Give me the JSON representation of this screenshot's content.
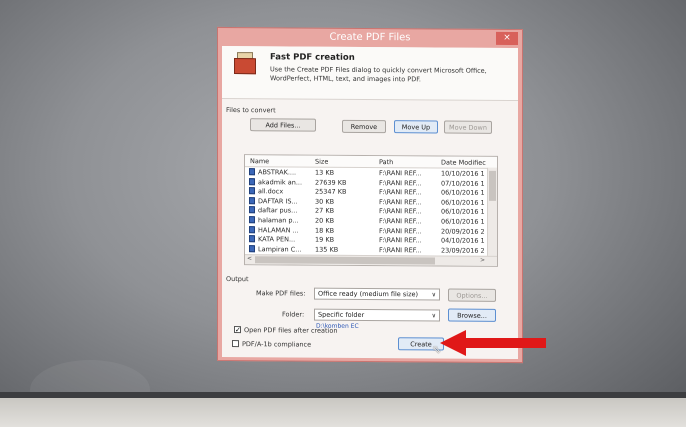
{
  "window": {
    "title": "Create PDF Files",
    "close_label": "×"
  },
  "header": {
    "title": "Fast PDF creation",
    "description": "Use the Create PDF Files dialog to quickly convert Microsoft Office, WordPerfect, HTML, text, and images into PDF."
  },
  "files_section": {
    "label": "Files to convert",
    "buttons": {
      "add": "Add Files...",
      "remove": "Remove",
      "move_up": "Move Up",
      "move_down": "Move Down"
    },
    "columns": [
      "Name",
      "Size",
      "Path",
      "Date Modifiec"
    ],
    "rows": [
      {
        "name": "ABSTRAK....",
        "size": "13 KB",
        "path": "F:\\RANI REF...",
        "date": "10/10/2016 1"
      },
      {
        "name": "akadmik an...",
        "size": "27639 KB",
        "path": "F:\\RANI REF...",
        "date": "07/10/2016 1"
      },
      {
        "name": "all.docx",
        "size": "25347 KB",
        "path": "F:\\RANI REF...",
        "date": "06/10/2016 1"
      },
      {
        "name": "DAFTAR IS...",
        "size": "30 KB",
        "path": "F:\\RANI REF...",
        "date": "06/10/2016 1"
      },
      {
        "name": "daftar pus...",
        "size": "27 KB",
        "path": "F:\\RANI REF...",
        "date": "06/10/2016 1"
      },
      {
        "name": "halaman p...",
        "size": "20 KB",
        "path": "F:\\RANI REF...",
        "date": "06/10/2016 1"
      },
      {
        "name": "HALAMAN ...",
        "size": "18 KB",
        "path": "F:\\RANI REF...",
        "date": "20/09/2016 2"
      },
      {
        "name": "KATA PEN...",
        "size": "19 KB",
        "path": "F:\\RANI REF...",
        "date": "04/10/2016 1"
      },
      {
        "name": "Lampiran C...",
        "size": "135 KB",
        "path": "F:\\RANI REF...",
        "date": "23/09/2016 2"
      }
    ]
  },
  "output": {
    "label": "Output",
    "make_pdf_label": "Make PDF files:",
    "make_pdf_value": "Office ready (medium file size)",
    "options_button": "Options...",
    "folder_label": "Folder:",
    "folder_value": "Specific folder",
    "browse_button": "Browse...",
    "folder_path": "D:\\komben EC"
  },
  "checks": {
    "pdfa_label": "PDF/A-1b compliance",
    "pdfa_checked": false,
    "open_after_label": "Open PDF files after creation",
    "open_after_checked": true,
    "check_mark": "✓"
  },
  "create_button": "Create",
  "colors": {
    "dialog_frame": "#e8a7a2",
    "annotation_arrow": "#e01818",
    "link_blue": "#2a56b5"
  }
}
